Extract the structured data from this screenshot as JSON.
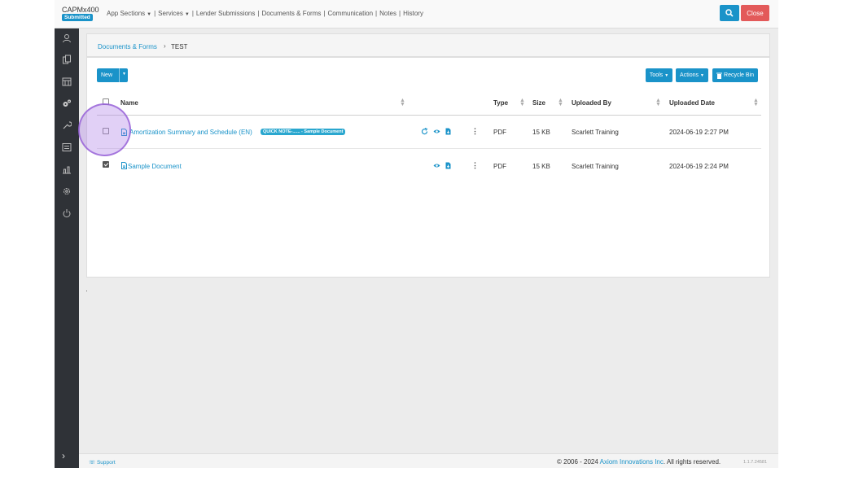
{
  "brand": {
    "name": "CAPMx400",
    "status_badge": "Submitted"
  },
  "topnav": {
    "items": [
      "App Sections",
      "Services",
      "Lender Submissions",
      "Documents & Forms",
      "Communication",
      "Notes",
      "History"
    ]
  },
  "topbar": {
    "close_label": "Close",
    "search_icon": "search-icon",
    "accent_color": "#1a93c9",
    "danger_color": "#e35a5a"
  },
  "sidebar": {
    "icons": [
      "contacts-icon",
      "copy-icon",
      "calendar-icon",
      "cogs-icon",
      "wrench-icon",
      "list-icon",
      "bar-chart-icon",
      "gear-icon",
      "power-icon"
    ],
    "expand_icon": "chevron-right-icon"
  },
  "breadcrumb": {
    "parent": "Documents & Forms",
    "separator": "›",
    "current": "TEST"
  },
  "toolbar": {
    "new_label": "New",
    "tools_label": "Tools",
    "actions_label": "Actions",
    "recycle_label": "Recycle Bin"
  },
  "table": {
    "columns": [
      "Name",
      "Type",
      "Size",
      "Uploaded By",
      "Uploaded Date"
    ],
    "rows": [
      {
        "checked": false,
        "name": "Amortization Summary and Schedule (EN)",
        "note": "QUICK NOTE-...... - Sample Document",
        "type": "PDF",
        "size": "15 KB",
        "uploaded_by": "Scarlett Training",
        "uploaded_date": "2024-06-19 2:27 PM",
        "actions": [
          "refresh-icon",
          "eye-icon",
          "file-download-icon"
        ]
      },
      {
        "checked": true,
        "name": "Sample Document",
        "note": "",
        "type": "PDF",
        "size": "15 KB",
        "uploaded_by": "Scarlett Training",
        "uploaded_date": "2024-06-19 2:24 PM",
        "actions": [
          "eye-icon",
          "file-download-icon"
        ]
      }
    ]
  },
  "footer": {
    "support_label": "Support",
    "copyright_prefix": "© 2006 - 2024 ",
    "company": "Axiom Innovations Inc",
    "copyright_suffix": ". All rights reserved.",
    "version": "1.1.7.24581"
  }
}
